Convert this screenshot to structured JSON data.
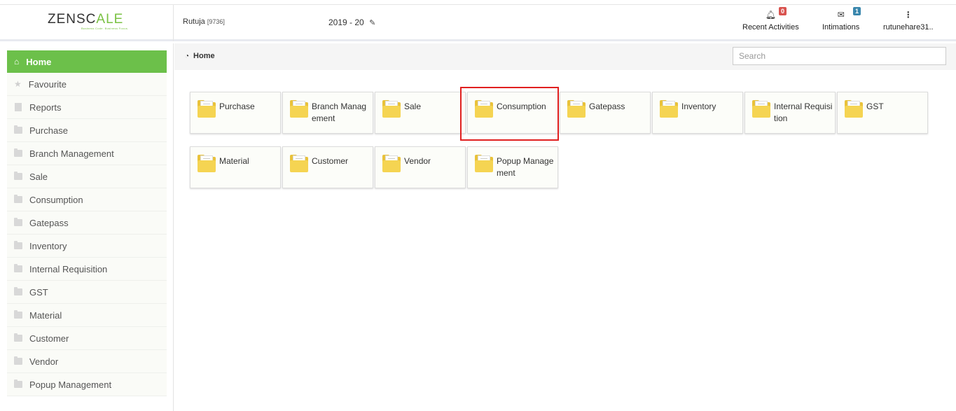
{
  "header": {
    "logo_prefix": "ZENSC",
    "logo_mid": "A",
    "logo_suffix": "LE",
    "logo_tagline": "Business Code. Business Focus.",
    "user_name": "Rutuja",
    "user_code": "[9736]",
    "financial_year": "2019 - 20",
    "recent_activities_label": "Recent Activities",
    "recent_activities_count": "0",
    "intimations_label": "Intimations",
    "intimations_count": "1",
    "user_menu_label": "rutunehare31.."
  },
  "sidebar": {
    "items": [
      {
        "label": "Home"
      },
      {
        "label": "Favourite"
      },
      {
        "label": "Reports"
      },
      {
        "label": "Purchase"
      },
      {
        "label": "Branch Management"
      },
      {
        "label": "Sale"
      },
      {
        "label": "Consumption"
      },
      {
        "label": "Gatepass"
      },
      {
        "label": "Inventory"
      },
      {
        "label": "Internal Requisition"
      },
      {
        "label": "GST"
      },
      {
        "label": "Material"
      },
      {
        "label": "Customer"
      },
      {
        "label": "Vendor"
      },
      {
        "label": "Popup Management"
      }
    ]
  },
  "breadcrumb": {
    "label": "Home"
  },
  "search": {
    "placeholder": "Search"
  },
  "tiles": [
    {
      "label": "Purchase"
    },
    {
      "label": "Branch Management"
    },
    {
      "label": "Sale"
    },
    {
      "label": "Consumption"
    },
    {
      "label": "Gatepass"
    },
    {
      "label": "Inventory"
    },
    {
      "label": "Internal Requisition"
    },
    {
      "label": "GST"
    },
    {
      "label": "Material"
    },
    {
      "label": "Customer"
    },
    {
      "label": "Vendor"
    },
    {
      "label": "Popup Management"
    }
  ],
  "colors": {
    "accent_green": "#6cc04a",
    "highlight_red": "#e02020",
    "folder_yellow": "#f5d452"
  },
  "icons": {
    "home": "home-icon",
    "favourite": "star-icon",
    "reports": "document-icon",
    "module": "folder-icon",
    "breadcrumb": "dashboard-icon",
    "recent_activities": "bell-icon",
    "intimations": "envelope-icon",
    "user_menu": "vertical-dots-icon",
    "fy_edit": "edit-icon"
  }
}
